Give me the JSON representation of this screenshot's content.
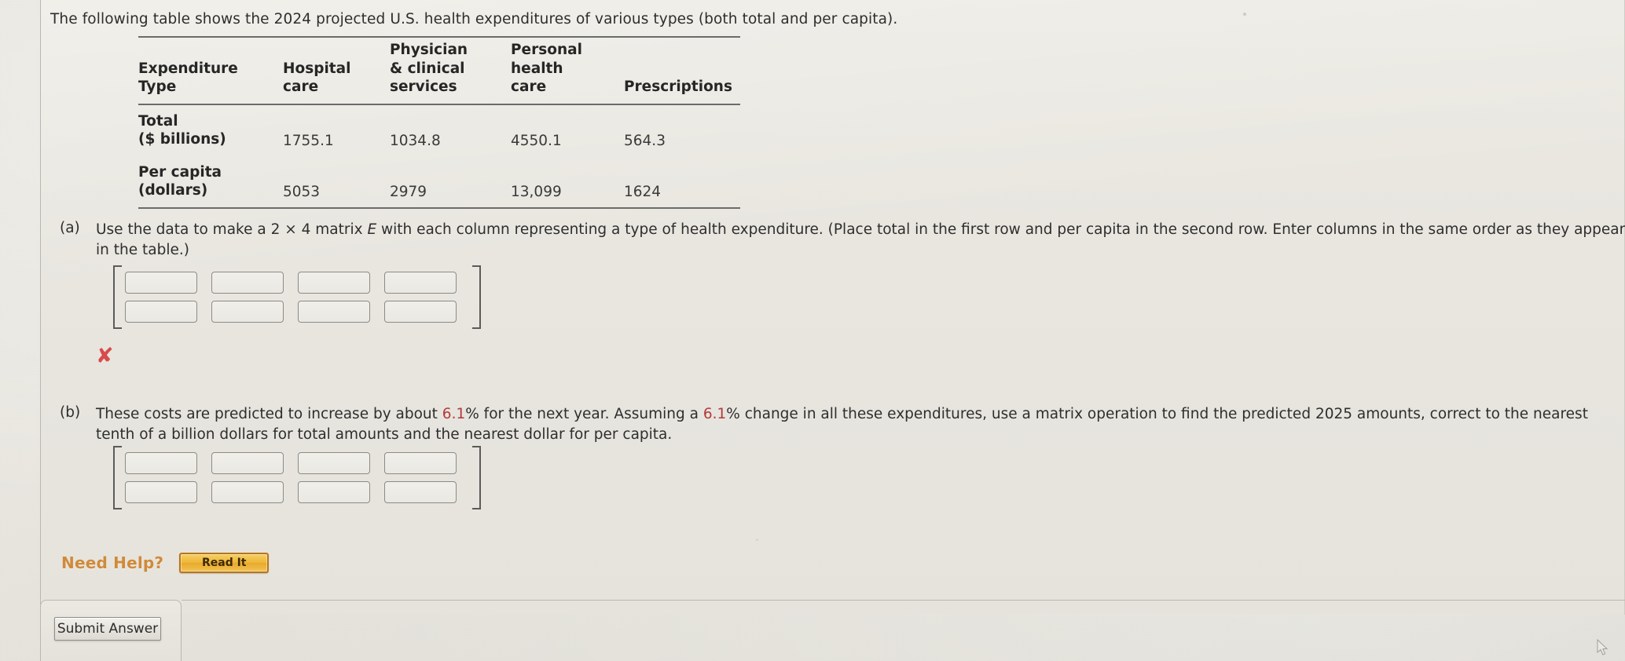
{
  "intro": {
    "text": "The following table shows the 2024 projected U.S. health expenditures of various types (both total and per capita)."
  },
  "table": {
    "headers": [
      "Expenditure\nType",
      "Hospital\ncare",
      "Physician\n& clinical\nservices",
      "Personal\nhealth\ncare",
      "Prescriptions"
    ],
    "rows": [
      {
        "label": "Total\n($ billions)",
        "values": [
          "1755.1",
          "1034.8",
          "4550.1",
          "564.3"
        ]
      },
      {
        "label": "Per capita\n(dollars)",
        "values": [
          "5053",
          "2979",
          "13,099",
          "1624"
        ]
      }
    ]
  },
  "questions": [
    {
      "label": "(a)",
      "text_part1": "Use the data to make a 2 × 4 matrix ",
      "text_italic": "E",
      "text_part2": " with each column representing a type of health expenditure. (Place total in the first row and per capita in the second row. Enter columns in the same order as they appear in the table.)",
      "matrix": {
        "rows": 2,
        "cols": 4,
        "values": [
          [
            "",
            "",
            "",
            ""
          ],
          [
            "",
            "",
            "",
            ""
          ]
        ],
        "placeholder": ""
      },
      "feedback": {
        "icon": "cross-mark-icon",
        "symbol": "✘",
        "color": "#d94a4a"
      }
    },
    {
      "label": "(b)",
      "text_segments": [
        {
          "t": "These costs are predicted to increase by about ",
          "hl": false
        },
        {
          "t": "6.1",
          "hl": true
        },
        {
          "t": "% for the next year. Assuming a ",
          "hl": false
        },
        {
          "t": "6.1",
          "hl": true
        },
        {
          "t": "% change in all these expenditures, use a matrix operation to find the predicted 2025 amounts, correct to the nearest tenth of a billion dollars for total amounts and the nearest dollar for per capita.",
          "hl": false
        }
      ],
      "matrix": {
        "rows": 2,
        "cols": 4,
        "values": [
          [
            "",
            "",
            "",
            ""
          ],
          [
            "",
            "",
            "",
            ""
          ]
        ],
        "placeholder": ""
      }
    }
  ],
  "need_help": {
    "label": "Need Help?",
    "read_it_label": "Read It"
  },
  "footer": {
    "submit_label": "Submit Answer"
  },
  "colors": {
    "highlight_red": "#b33a3a",
    "wrong_mark": "#d94a4a",
    "need_help_orange": "#d08a3a",
    "read_it_gold": "#eeb73a",
    "page_bg": "#e8e6e0",
    "rule": "#6b6b6b"
  }
}
